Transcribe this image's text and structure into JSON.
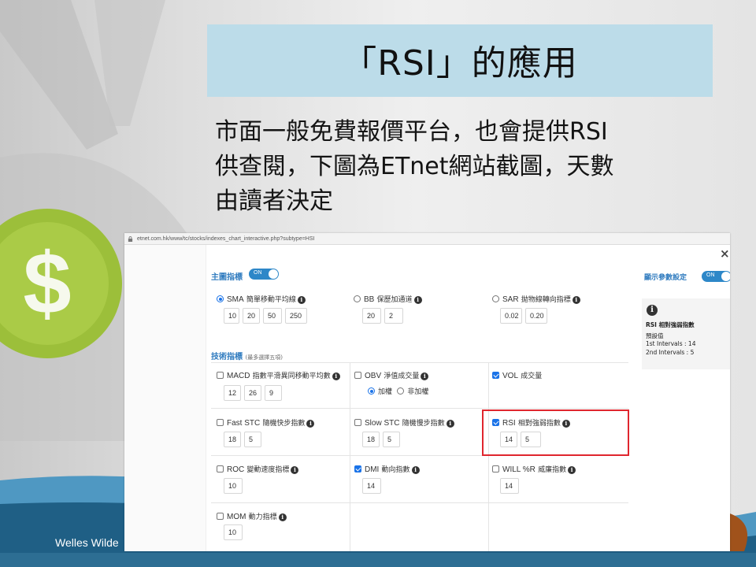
{
  "slide": {
    "title": "「RSI」的應用",
    "body_lines": [
      "市面一般免費報價平台，也會提供RSI",
      "供查閱，下圖為ETnet網站截圖，天數",
      "由讀者決定"
    ],
    "footer": "Welles Wilde",
    "colors": {
      "title_band": "#bcdce9",
      "wave_dark": "#1f5f85",
      "wave_light": "#4f98c2",
      "coin": "#9cbf3a"
    }
  },
  "browser": {
    "url": "etnet.com.hk/www/tc/stocks/indexes_chart_interactive.php?subtype=HSI",
    "close_glyph": "×"
  },
  "main_section": {
    "title": "主圖指標",
    "toggle_label": "ON",
    "items": [
      {
        "en": "SMA",
        "zh": "簡單移動平均線",
        "selected": true,
        "type": "radio",
        "values": [
          "10",
          "20",
          "50",
          "250"
        ]
      },
      {
        "en": "BB",
        "zh": "保歷加通道",
        "selected": false,
        "type": "radio",
        "values": [
          "20",
          "2"
        ]
      },
      {
        "en": "SAR",
        "zh": "拋物線轉向指標",
        "selected": false,
        "type": "radio",
        "values": [
          "0.02",
          "0.20"
        ]
      }
    ]
  },
  "tech_section": {
    "title": "技術指標",
    "note": "(最多選擇五項)",
    "items": [
      {
        "en": "MACD",
        "zh": "指數平滑異同移動平均數",
        "checked": false,
        "values": [
          "12",
          "26",
          "9"
        ]
      },
      {
        "en": "OBV",
        "zh": "淨值成交量",
        "checked": false,
        "values": []
      },
      {
        "en": "VOL",
        "zh": "成交量",
        "checked": true,
        "values": []
      },
      {
        "en": "Fast STC",
        "zh": "隨機快步指數",
        "checked": false,
        "values": [
          "18",
          "5"
        ]
      },
      {
        "en": "Slow STC",
        "zh": "隨機慢步指數",
        "checked": false,
        "values": [
          "18",
          "5"
        ]
      },
      {
        "en": "RSI",
        "zh": "相對強弱指數",
        "checked": true,
        "values": [
          "14",
          "5"
        ]
      },
      {
        "en": "ROC",
        "zh": "變動速度指標",
        "checked": false,
        "values": [
          "10"
        ]
      },
      {
        "en": "DMI",
        "zh": "動向指數",
        "checked": true,
        "values": [
          "14"
        ]
      },
      {
        "en": "WILL %R",
        "zh": "威廉指數",
        "checked": false,
        "values": [
          "14"
        ]
      },
      {
        "en": "MOM",
        "zh": "動力指標",
        "checked": false,
        "values": [
          "10"
        ]
      }
    ],
    "obv_options": [
      {
        "label": "加權",
        "selected": true
      },
      {
        "label": "非加權",
        "selected": false
      }
    ]
  },
  "side_panel": {
    "title": "顯示參數設定",
    "toggle_label": "ON",
    "info_glyph": "i",
    "info_title_en": "RSI",
    "info_title_zh": "相對強弱指數",
    "default_label": "預設值",
    "interval1": "1st Intervals : 14",
    "interval2": "2nd Intervals : 5"
  }
}
